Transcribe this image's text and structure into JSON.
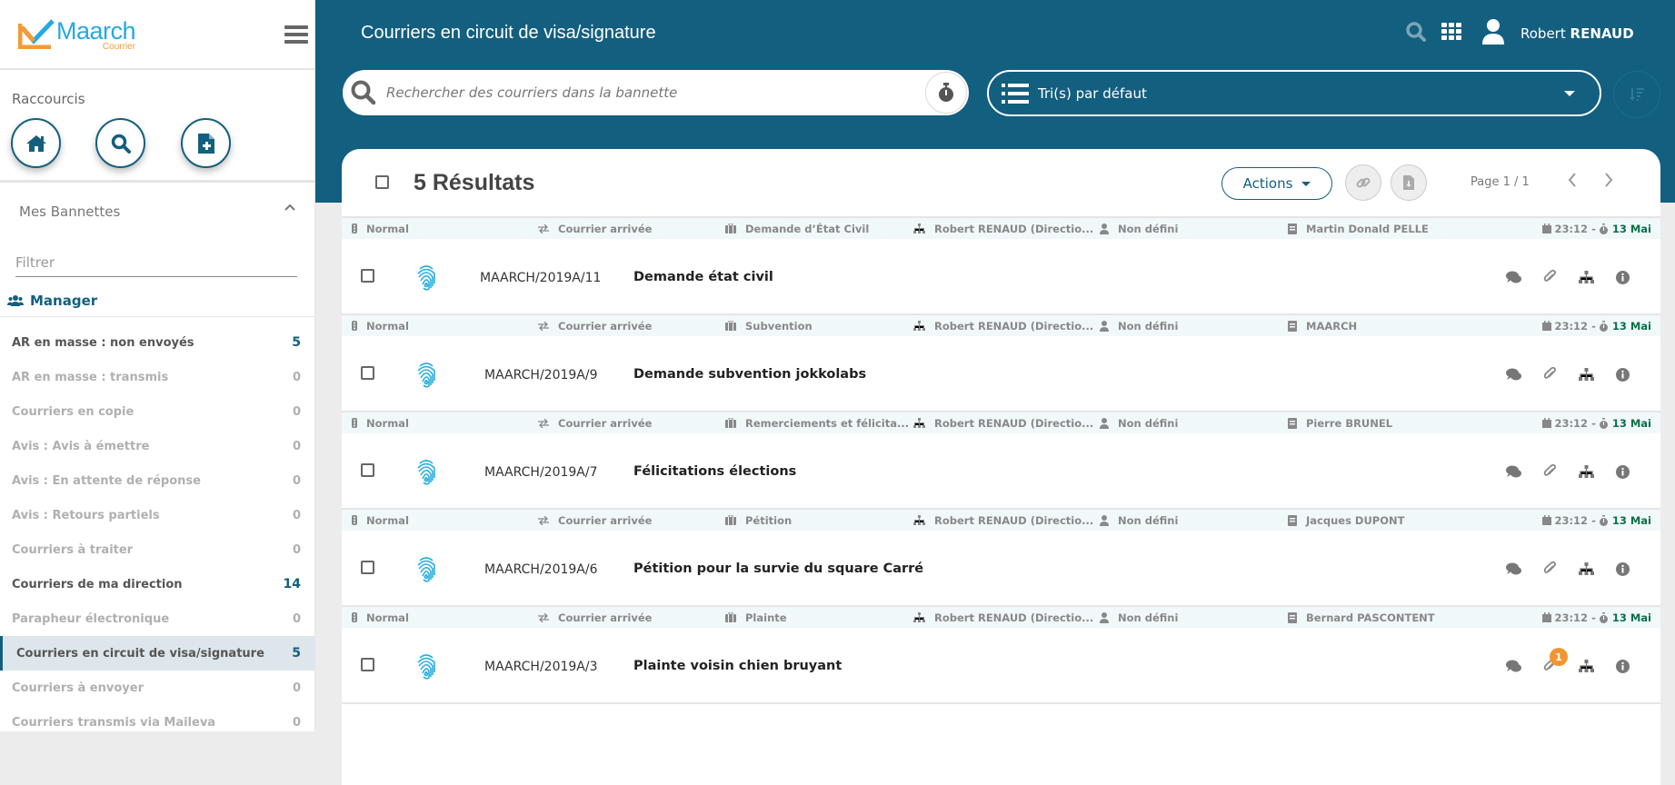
{
  "app": {
    "logo_name": "Maarch",
    "logo_subtitle": "Courrier",
    "page_title": "Courriers en circuit de visa/signature"
  },
  "colors": {
    "primary": "#135f7f",
    "logo_blue": "#25a9e0",
    "logo_orange": "#f49a36",
    "badge_orange": "#f29530",
    "deadline_green": "#0a7048"
  },
  "user": {
    "first_name": "Robert",
    "last_name": "RENAUD"
  },
  "sidebar": {
    "shortcuts_title": "Raccourcis",
    "shortcuts": [
      {
        "icon": "home-icon"
      },
      {
        "icon": "search-icon"
      },
      {
        "icon": "file-plus-icon"
      }
    ],
    "baskets_title": "Mes Bannettes",
    "filter_placeholder": "Filtrer",
    "group_label": "Manager",
    "baskets": [
      {
        "label": "AR en masse : non envoyés",
        "count": "5",
        "style": "dark"
      },
      {
        "label": "AR en masse : transmis",
        "count": "0",
        "style": "muted"
      },
      {
        "label": "Courriers en copie",
        "count": "0",
        "style": "muted"
      },
      {
        "label": "Avis : Avis à émettre",
        "count": "0",
        "style": "muted"
      },
      {
        "label": "Avis : En attente de réponse",
        "count": "0",
        "style": "muted"
      },
      {
        "label": "Avis : Retours partiels",
        "count": "0",
        "style": "muted"
      },
      {
        "label": "Courriers à traiter",
        "count": "0",
        "style": "muted"
      },
      {
        "label": "Courriers de ma direction",
        "count": "14",
        "style": "dark"
      },
      {
        "label": "Parapheur électronique",
        "count": "0",
        "style": "muted"
      },
      {
        "label": "Courriers en circuit de visa/signature",
        "count": "5",
        "style": "active"
      },
      {
        "label": "Courriers à envoyer",
        "count": "0",
        "style": "muted"
      },
      {
        "label": "Courriers transmis via Maileva",
        "count": "0",
        "style": "muted"
      }
    ]
  },
  "toolbar": {
    "search_placeholder": "Rechercher des courriers dans la bannette",
    "sort_label": "Tri(s) par défaut"
  },
  "results": {
    "count_label": "5 Résultats",
    "actions_label": "Actions",
    "page_label": "Page 1 / 1"
  },
  "mails": [
    {
      "priority": "Normal",
      "category": "Courrier arrivée",
      "doctype": "Demande d’État Civil",
      "entity": "Robert RENAUD (Directio...",
      "assignee": "Non défini",
      "contact": "Martin Donald PELLE",
      "time": "23:12 -",
      "deadline": "13 Mai",
      "ref": "MAARCH/2019A/11",
      "subject": "Demande état civil",
      "attachments_badge": ""
    },
    {
      "priority": "Normal",
      "category": "Courrier arrivée",
      "doctype": "Subvention",
      "entity": "Robert RENAUD (Directio...",
      "assignee": "Non défini",
      "contact": "MAARCH",
      "time": "23:12 -",
      "deadline": "13 Mai",
      "ref": "MAARCH/2019A/9",
      "subject": "Demande subvention jokkolabs",
      "attachments_badge": ""
    },
    {
      "priority": "Normal",
      "category": "Courrier arrivée",
      "doctype": "Remerciements et félicita...",
      "entity": "Robert RENAUD (Directio...",
      "assignee": "Non défini",
      "contact": "Pierre BRUNEL",
      "time": "23:12 -",
      "deadline": "13 Mai",
      "ref": "MAARCH/2019A/7",
      "subject": "Félicitations élections",
      "attachments_badge": ""
    },
    {
      "priority": "Normal",
      "category": "Courrier arrivée",
      "doctype": "Pétition",
      "entity": "Robert RENAUD (Directio...",
      "assignee": "Non défini",
      "contact": "Jacques DUPONT",
      "time": "23:12 -",
      "deadline": "13 Mai",
      "ref": "MAARCH/2019A/6",
      "subject": "Pétition pour la survie du square Carré",
      "attachments_badge": ""
    },
    {
      "priority": "Normal",
      "category": "Courrier arrivée",
      "doctype": "Plainte",
      "entity": "Robert RENAUD (Directio...",
      "assignee": "Non défini",
      "contact": "Bernard PASCONTENT",
      "time": "23:12 -",
      "deadline": "13 Mai",
      "ref": "MAARCH/2019A/3",
      "subject": "Plainte voisin chien bruyant",
      "attachments_badge": "1"
    }
  ]
}
